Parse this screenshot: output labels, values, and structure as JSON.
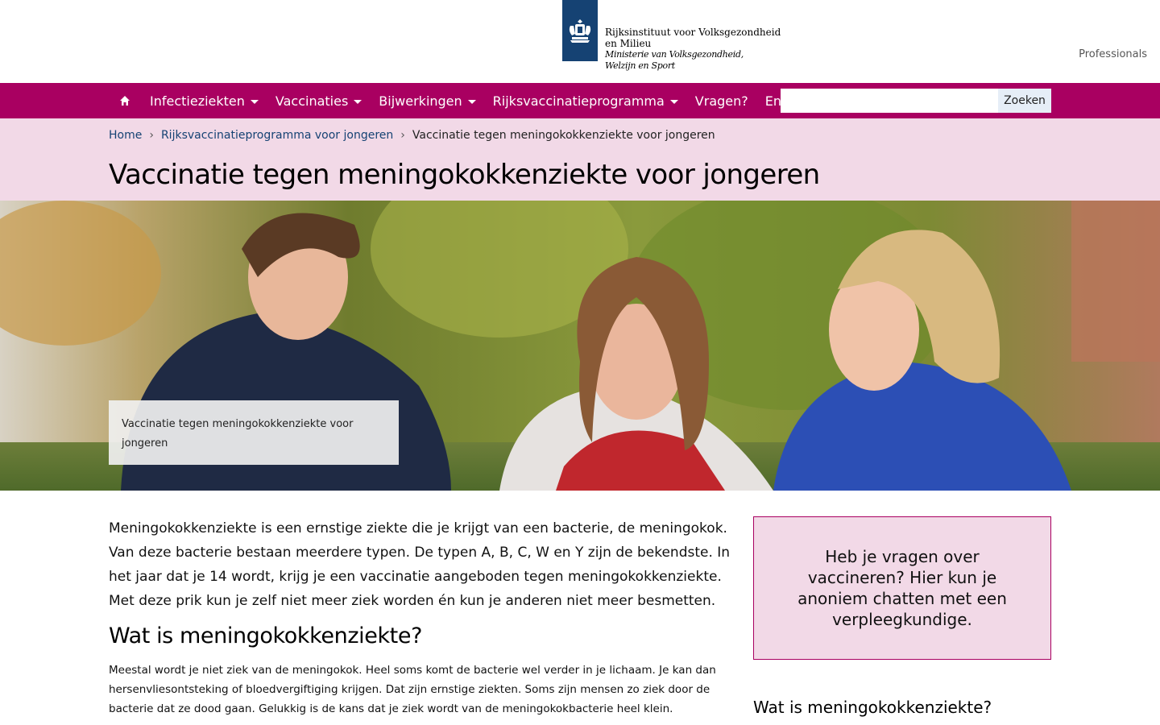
{
  "header": {
    "logo_line1": "Rijksinstituut voor Volksgezondheid",
    "logo_line2": "en Milieu",
    "logo_line3": "Ministerie van Volksgezondheid,",
    "logo_line4": "Welzijn en Sport",
    "professionals_link": "Professionals"
  },
  "nav": {
    "home_icon": "home-icon",
    "items": [
      {
        "label": "Infectieziekten",
        "dropdown": true
      },
      {
        "label": "Vaccinaties",
        "dropdown": true
      },
      {
        "label": "Bijwerkingen",
        "dropdown": true
      },
      {
        "label": "Rijksvaccinatieprogramma",
        "dropdown": true
      },
      {
        "label": "Vragen?",
        "dropdown": false
      },
      {
        "label": "English",
        "dropdown": false
      }
    ],
    "search_value": "",
    "search_button": "Zoeken"
  },
  "breadcrumb": {
    "home": "Home",
    "parent": "Rijksvaccinatieprogramma voor jongeren",
    "current": "Vaccinatie tegen meningokokkenziekte voor jongeren"
  },
  "page": {
    "title": "Vaccinatie tegen meningokokkenziekte voor jongeren",
    "hero_caption": "Vaccinatie tegen meningokokkenziekte voor jongeren",
    "intro": "Meningokokkenziekte is een ernstige ziekte die je krijgt van een bacterie, de meningokok. Van deze bacterie bestaan meerdere typen. De typen A, B, C, W en Y zijn de bekendste. In het jaar dat je 14 wordt, krijg je een vaccinatie aangeboden tegen meningokokkenziekte. Met deze prik kun je zelf niet meer ziek worden én kun je anderen niet meer besmetten.",
    "section_heading": "Wat is meningokokkenziekte?",
    "section_body": "Meestal wordt je niet ziek van de meningokok. Heel soms komt de bacterie wel verder in je lichaam. Je kan dan hersenvliesontsteking of bloedvergiftiging krijgen. Dat zijn ernstige ziekten. Soms zijn mensen zo ziek door de bacterie dat ze dood gaan. Gelukkig is de kans dat je ziek wordt van de meningokokbacterie heel klein."
  },
  "sidebar": {
    "chat_text": "Heb je vragen over vaccineren? Hier kun je anoniem chatten met een verpleegkundige.",
    "heading": "Wat is meningokokkenziekte?"
  },
  "colors": {
    "brand_magenta": "#a90061",
    "band_pink": "#f2d9e7",
    "logo_blue": "#154273"
  }
}
